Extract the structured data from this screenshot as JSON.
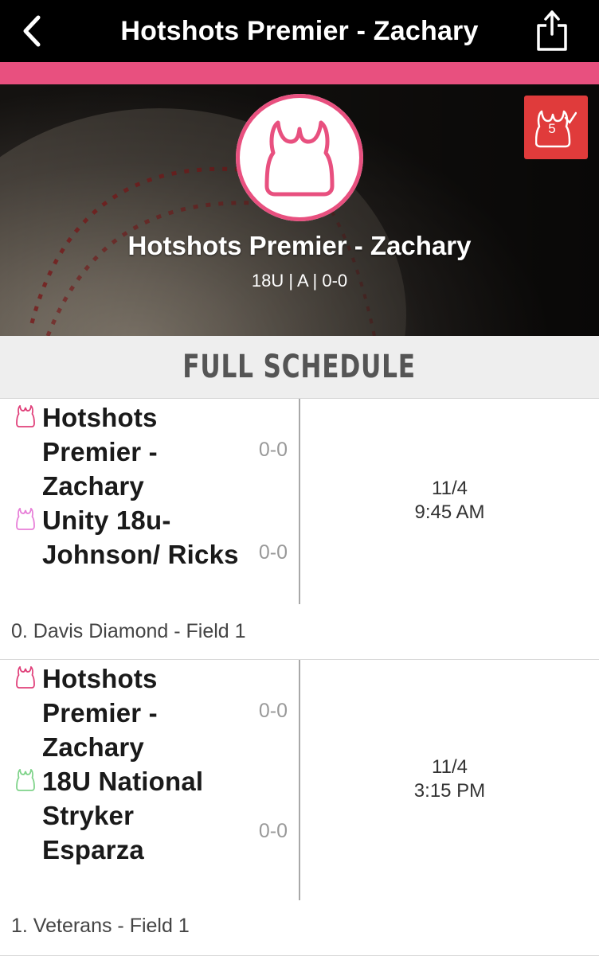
{
  "topbar": {
    "title": "Hotshots Premier - Zachary",
    "back_icon": "chevron-left-icon",
    "share_icon": "share-icon"
  },
  "hero": {
    "team_name": "Hotshots Premier - Zachary",
    "meta": "18U | A | 0-0",
    "logo_icon": "jersey-icon",
    "badge_icon": "jersey-check-icon",
    "badge_number": "5"
  },
  "section": {
    "title": "FULL SCHEDULE"
  },
  "games": [
    {
      "teams": [
        {
          "name": "Hotshots Premier - Zachary",
          "score": "0-0",
          "jersey_color": "#e0407a"
        },
        {
          "name": "Unity 18u-Johnson/ Ricks",
          "score": "0-0",
          "jersey_color": "#e77fd8"
        }
      ],
      "date": "11/4",
      "time": "9:45 AM",
      "venue": "0. Davis Diamond - Field 1"
    },
    {
      "teams": [
        {
          "name": "Hotshots Premier - Zachary",
          "score": "0-0",
          "jersey_color": "#e0407a"
        },
        {
          "name": "18U National Stryker Esparza",
          "score": "0-0",
          "jersey_color": "#7fd38a"
        }
      ],
      "date": "11/4",
      "time": "3:15 PM",
      "venue": "1. Veterans - Field 1"
    }
  ],
  "colors": {
    "accent_pink": "#e8507f",
    "badge_red": "#e03b3b",
    "topbar_bg": "#000000"
  }
}
